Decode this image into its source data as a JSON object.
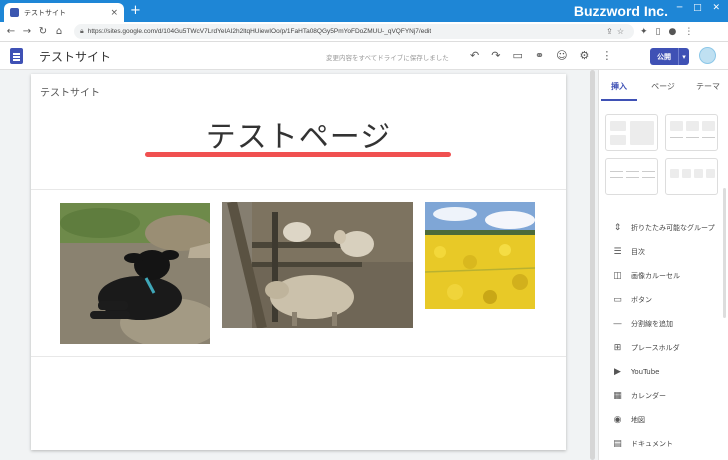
{
  "browser": {
    "tab_title": "テストサイト",
    "tab_close": "×",
    "new_tab": "+",
    "brand": "Buzzword Inc.",
    "window_controls": "─ □ ✕",
    "url": "https://sites.google.com/d/104Gu5TWcV7LrdYeIAI2h2ltqHUiewIOo/p/1FaHTa08QGy5PmYoFDoZMUU-_qVQFYNj7/edit"
  },
  "sites": {
    "site_name": "テストサイト",
    "saved_message": "変更内容をすべてドライブに保存しました",
    "publish_label": "公開"
  },
  "page": {
    "site_title": "テストサイト",
    "heading": "テストページ",
    "accent_color": "#f05050"
  },
  "panel": {
    "tabs": [
      "挿入",
      "ページ",
      "テーマ"
    ],
    "items": [
      {
        "icon": "collapsible-icon",
        "glyph": "⇕",
        "label": "折りたたみ可能なグループ"
      },
      {
        "icon": "toc-icon",
        "glyph": "☰",
        "label": "目次"
      },
      {
        "icon": "carousel-icon",
        "glyph": "◫",
        "label": "画像カルーセル"
      },
      {
        "icon": "button-icon",
        "glyph": "▭",
        "label": "ボタン"
      },
      {
        "icon": "divider-icon",
        "glyph": "—",
        "label": "分割線を追加"
      },
      {
        "icon": "placeholder-icon",
        "glyph": "⊞",
        "label": "プレースホルダ"
      },
      {
        "icon": "youtube-icon",
        "glyph": "▶",
        "label": "YouTube"
      },
      {
        "icon": "calendar-icon",
        "glyph": "▦",
        "label": "カレンダー"
      },
      {
        "icon": "map-icon",
        "glyph": "◉",
        "label": "地図"
      },
      {
        "icon": "docs-icon",
        "glyph": "▤",
        "label": "ドキュメント"
      }
    ]
  }
}
